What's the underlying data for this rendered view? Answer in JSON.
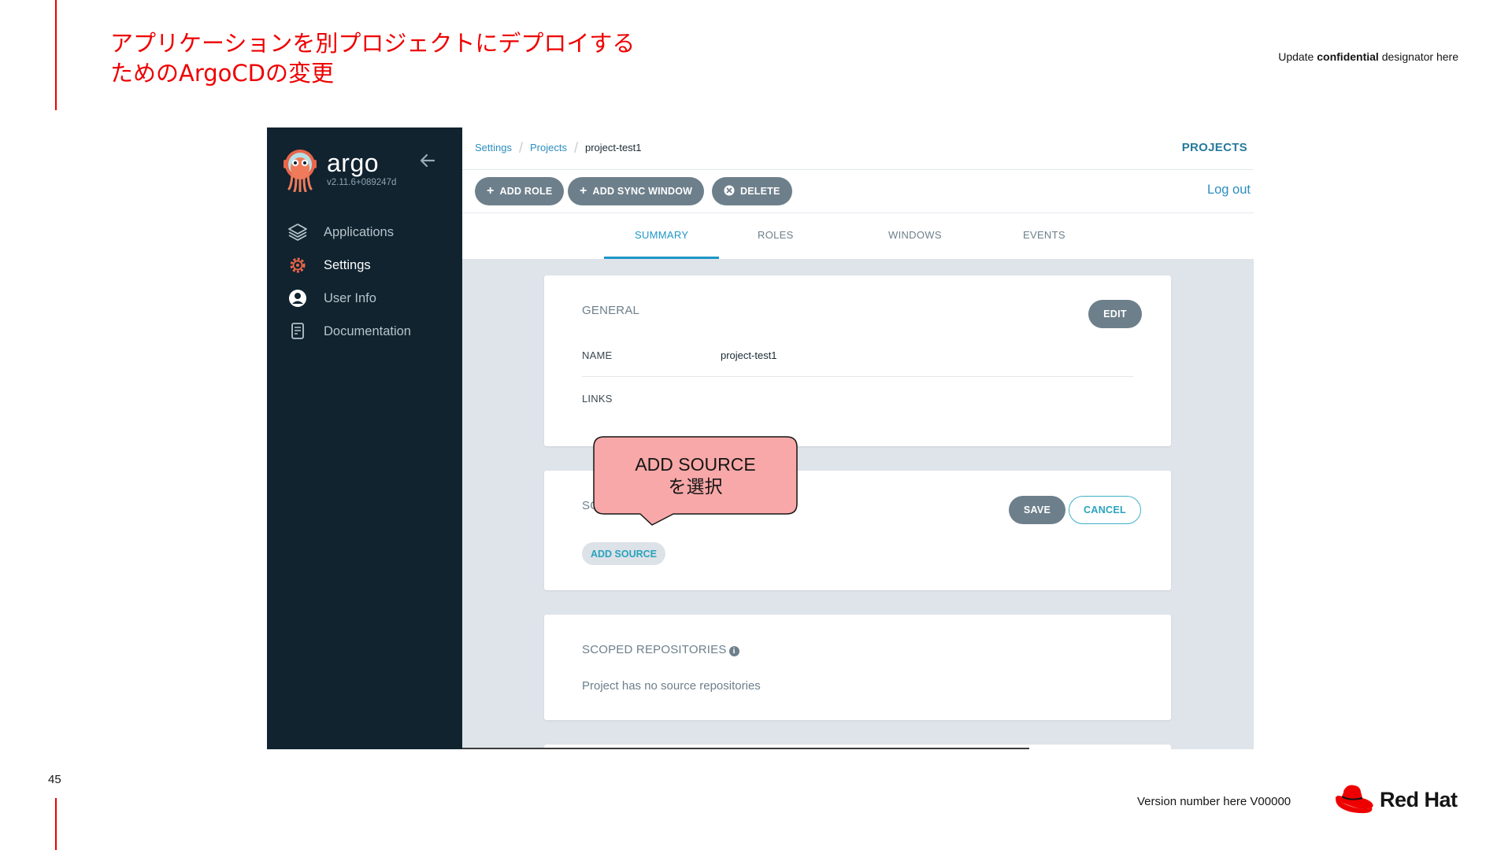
{
  "slide": {
    "title_line1": "アプリケーションを別プロジェクトにデプロイする",
    "title_line2": "ためのArgoCDの変更",
    "confidential_prefix": "Update ",
    "confidential_bold": "confidential",
    "confidential_suffix": " designator here",
    "page_number": "45",
    "version": "Version number here V00000",
    "brand": "Red Hat",
    "accent_color": "#ee0000"
  },
  "argo": {
    "brand_name": "argo",
    "version": "v2.11.6+089247d",
    "sidebar": {
      "items": [
        {
          "label": "Applications",
          "icon": "layers-icon",
          "active": false
        },
        {
          "label": "Settings",
          "icon": "gear-icon",
          "active": true
        },
        {
          "label": "User Info",
          "icon": "user-circle-icon",
          "active": false
        },
        {
          "label": "Documentation",
          "icon": "document-icon",
          "active": false
        }
      ]
    },
    "breadcrumb": {
      "settings": "Settings",
      "projects": "Projects",
      "current": "project-test1"
    },
    "header_right": "PROJECTS",
    "actions": {
      "add_role": "ADD ROLE",
      "add_sync_window": "ADD SYNC WINDOW",
      "delete": "DELETE",
      "logout": "Log out"
    },
    "tabs": {
      "summary": "SUMMARY",
      "roles": "ROLES",
      "windows": "WINDOWS",
      "events": "EVENTS"
    },
    "general": {
      "heading": "GENERAL",
      "edit": "EDIT",
      "name_label": "NAME",
      "name_value": "project-test1",
      "links_label": "LINKS"
    },
    "sources": {
      "heading_visible": "SO",
      "save": "SAVE",
      "cancel": "CANCEL",
      "add_source": "ADD SOURCE"
    },
    "scoped": {
      "heading": "SCOPED REPOSITORIES",
      "info_icon": "info-icon",
      "empty": "Project has no source repositories"
    },
    "colors": {
      "sidebar_bg": "#10232f",
      "content_bg": "#dee4ea",
      "link": "#2c8ec0",
      "tab_active": "#1f96c7",
      "pill": "#6d7f8b"
    }
  },
  "callout": {
    "line1": "ADD SOURCE",
    "line2": "を選択",
    "fill": "#f8a8a8"
  }
}
